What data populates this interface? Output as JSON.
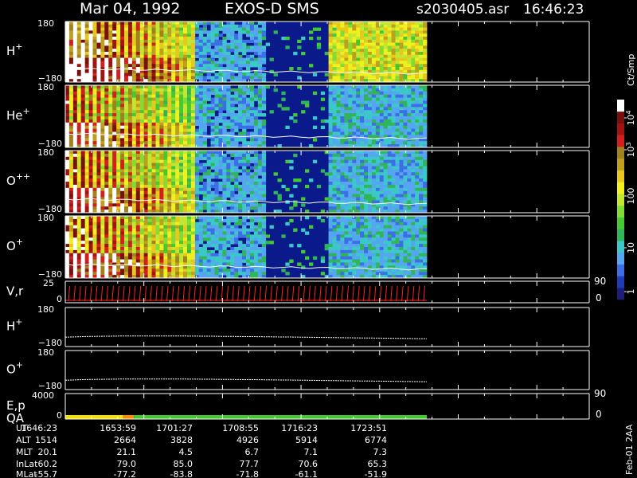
{
  "header": {
    "date": "Mar 04, 1992",
    "instrument": "EXOS-D SMS",
    "file": "s2030405.asr",
    "time": "16:46:23"
  },
  "footer_note": "Feb-01 2AA",
  "colors": {
    "background": "#000000",
    "text": "#ffffff",
    "spectrogram_base": "#0a1a8a",
    "velocity_trace": "#ff2020",
    "qa_yellow": "#f2e000",
    "qa_orange": "#ff8c00",
    "qa_green": "#44c830"
  },
  "colorbar": {
    "title": "Ct/Smp",
    "scale": "log",
    "range": [
      1,
      10000
    ],
    "tick_labels": [
      "1",
      "10",
      "100",
      "10",
      "10"
    ],
    "tick_exponents": [
      "",
      "",
      "",
      "3",
      "4"
    ],
    "colors": [
      "#1e1e78",
      "#1e3cb4",
      "#3c6ee6",
      "#55a5f0",
      "#3cc8c8",
      "#32b45a",
      "#46c832",
      "#82dc32",
      "#c3e632",
      "#f0f01e",
      "#e6c81e",
      "#bea01e",
      "#a0821e",
      "#d22020",
      "#a01414",
      "#781010",
      "#ffffff"
    ]
  },
  "chart_data": {
    "type": "heatmap",
    "time_axis": {
      "label_names": [
        "UT",
        "ALT",
        "MLT",
        "InLat",
        "MLat"
      ],
      "columns": [
        {
          "UT": "1646:23",
          "ALT": "1514",
          "MLT": "20.1",
          "InLat": "60.2",
          "MLat": "-55.7"
        },
        {
          "UT": "1653:59",
          "ALT": "2664",
          "MLT": "21.1",
          "InLat": "79.0",
          "MLat": "-77.2"
        },
        {
          "UT": "1701:27",
          "ALT": "3828",
          "MLT": "4.5",
          "InLat": "85.0",
          "MLat": "-83.8"
        },
        {
          "UT": "1708:55",
          "ALT": "4926",
          "MLT": "6.7",
          "InLat": "77.7",
          "MLat": "-71.8"
        },
        {
          "UT": "1716:23",
          "ALT": "5914",
          "MLT": "7.1",
          "InLat": "70.6",
          "MLat": "-61.1"
        },
        {
          "UT": "1723:51",
          "ALT": "6774",
          "MLT": "7.3",
          "InLat": "65.3",
          "MLat": "-51.9"
        }
      ]
    },
    "panels": [
      {
        "label": "H",
        "superscript": "+",
        "y_top": "180",
        "y_bottom": "−180",
        "kind": "spectrogram",
        "intensity": 1.0
      },
      {
        "label": "He",
        "superscript": "+",
        "y_top": "180",
        "y_bottom": "−180",
        "kind": "spectrogram",
        "intensity": 0.65
      },
      {
        "label": "O",
        "superscript": "++",
        "y_top": "180",
        "y_bottom": "−180",
        "kind": "spectrogram",
        "intensity": 0.75
      },
      {
        "label": "O",
        "superscript": "+",
        "y_top": "180",
        "y_bottom": "−180",
        "kind": "spectrogram",
        "intensity": 0.8
      },
      {
        "label": "V,r",
        "superscript": "",
        "y_top": "25",
        "y_bottom": "0",
        "right_top": "90",
        "right_bottom": "0",
        "kind": "velocity"
      },
      {
        "label": "H",
        "superscript": "+",
        "y_top": "180",
        "y_bottom": "−180",
        "kind": "line"
      },
      {
        "label": "O",
        "superscript": "+",
        "y_top": "180",
        "y_bottom": "−180",
        "kind": "line"
      },
      {
        "label": "E,p",
        "label2": "QA",
        "superscript": "",
        "y_top": "4000",
        "y_bottom": "0",
        "right_top": "90",
        "right_bottom": "0",
        "kind": "qa"
      }
    ],
    "qa_bar": [
      {
        "from": 0.0,
        "to": 0.16,
        "color": "yellow"
      },
      {
        "from": 0.16,
        "to": 0.19,
        "color": "orange"
      },
      {
        "from": 0.19,
        "to": 1.0,
        "color": "green"
      }
    ],
    "data_coverage_fraction": 0.69
  }
}
